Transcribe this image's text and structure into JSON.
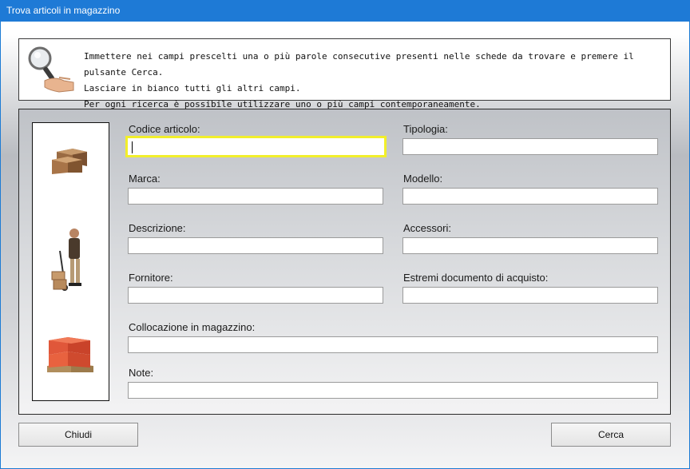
{
  "window": {
    "title": "Trova articoli in magazzino"
  },
  "info": {
    "icon": "magnifier-hand-icon",
    "lines": [
      "Immettere nei campi prescelti una o più parole consecutive presenti nelle schede da trovare e premere il pulsante Cerca.",
      "Lasciare in bianco tutti gli altri campi.",
      "Per ogni ricerca è possibile utilizzare uno o più campi contemporaneamente."
    ]
  },
  "side_images": [
    "boxes-icon",
    "delivery-man-icon",
    "pallet-boxes-icon"
  ],
  "fields": {
    "codice": {
      "label": "Codice articolo:",
      "value": ""
    },
    "tipologia": {
      "label": "Tipologia:",
      "value": ""
    },
    "marca": {
      "label": "Marca:",
      "value": ""
    },
    "modello": {
      "label": "Modello:",
      "value": ""
    },
    "descrizione": {
      "label": "Descrizione:",
      "value": ""
    },
    "accessori": {
      "label": "Accessori:",
      "value": ""
    },
    "fornitore": {
      "label": "Fornitore:",
      "value": ""
    },
    "estremi": {
      "label": "Estremi documento di acquisto:",
      "value": ""
    },
    "collocazione": {
      "label": "Collocazione in magazzino:",
      "value": ""
    },
    "note": {
      "label": "Note:",
      "value": ""
    }
  },
  "buttons": {
    "close": "Chiudi",
    "search": "Cerca"
  },
  "colors": {
    "titlebar": "#1e7ad6",
    "focus_border": "#f2ef2a"
  }
}
